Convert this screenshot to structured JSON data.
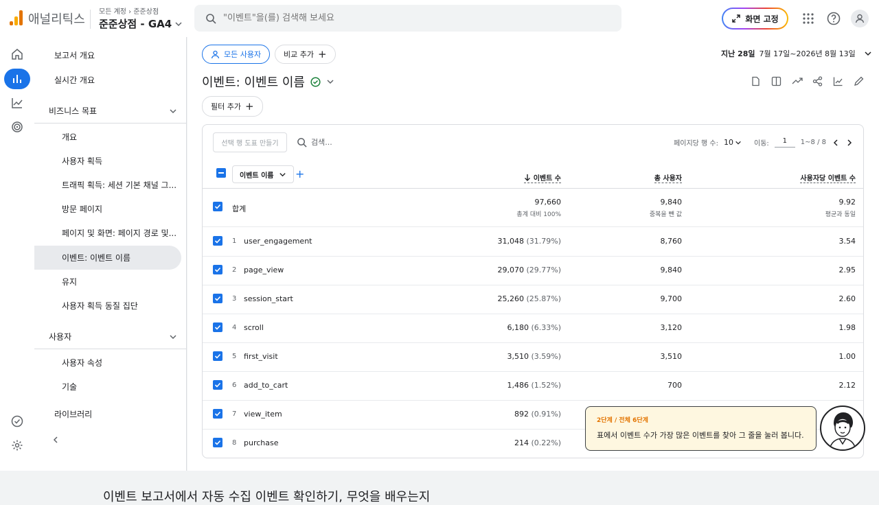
{
  "app": {
    "name": "애널리틱스",
    "account_crumb": [
      "모든 계정",
      "준준상점"
    ],
    "property": "준준상점 - GA4"
  },
  "search": {
    "placeholder": "\"이벤트\"을(를) 검색해 보세요"
  },
  "top": {
    "pin_label": "화면 고정"
  },
  "nav": {
    "items": [
      {
        "label": "보고서 개요"
      },
      {
        "label": "실시간 개요"
      }
    ],
    "section_business": "비즈니스 목표",
    "business_items": [
      {
        "label": "개요"
      },
      {
        "label": "사용자 획득"
      },
      {
        "label": "트래픽 획득: 세션 기본 채널 그..."
      },
      {
        "label": "방문 페이지"
      },
      {
        "label": "페이지 및 화면: 페이지 경로 및..."
      },
      {
        "label": "이벤트: 이벤트 이름"
      },
      {
        "label": "유지"
      },
      {
        "label": "사용자 획득 동질 집단"
      }
    ],
    "section_users": "사용자",
    "user_items": [
      {
        "label": "사용자 속성"
      },
      {
        "label": "기술"
      }
    ],
    "library": "라이브러리"
  },
  "toolbar": {
    "all_users": "모든 사용자",
    "compare": "비교 추가",
    "filter": "필터 추가"
  },
  "date": {
    "preset": "지난 28일",
    "range": "7월 17일~2026년 8월 13일"
  },
  "title": "이벤트: 이벤트 이름",
  "table": {
    "make_chart": "선택 행 도표 만들기",
    "search_placeholder": "검색...",
    "rows_per_page_label": "페이지당 행 수:",
    "rows_per_page": "10",
    "goto_label": "이동:",
    "goto_value": "1",
    "range": "1~8 / 8",
    "dimension": "이벤트 이름",
    "headers": {
      "events": "이벤트 수",
      "users": "총 사용자",
      "per_user": "사용자당 이벤트 수"
    },
    "total": {
      "label": "합계",
      "events": "97,660",
      "events_sub": "총계 대비 100%",
      "users": "9,840",
      "users_sub": "중복을 뺀 값",
      "per_user": "9.92",
      "per_user_sub": "평균과 동일"
    },
    "rows": [
      {
        "idx": "1",
        "name": "user_engagement",
        "events": "31,048",
        "pct": "(31.79%)",
        "users": "8,760",
        "per_user": "3.54"
      },
      {
        "idx": "2",
        "name": "page_view",
        "events": "29,070",
        "pct": "(29.77%)",
        "users": "9,840",
        "per_user": "2.95"
      },
      {
        "idx": "3",
        "name": "session_start",
        "events": "25,260",
        "pct": "(25.87%)",
        "users": "9,700",
        "per_user": "2.60"
      },
      {
        "idx": "4",
        "name": "scroll",
        "events": "6,180",
        "pct": "(6.33%)",
        "users": "3,120",
        "per_user": "1.98"
      },
      {
        "idx": "5",
        "name": "first_visit",
        "events": "3,510",
        "pct": "(3.59%)",
        "users": "3,510",
        "per_user": "1.00"
      },
      {
        "idx": "6",
        "name": "add_to_cart",
        "events": "1,486",
        "pct": "(1.52%)",
        "users": "700",
        "per_user": "2.12"
      },
      {
        "idx": "7",
        "name": "view_item",
        "events": "892",
        "pct": "(0.91%)",
        "users": "",
        "per_user": ""
      },
      {
        "idx": "8",
        "name": "purchase",
        "events": "214",
        "pct": "(0.22%)",
        "users": "",
        "per_user": ""
      }
    ]
  },
  "tip": {
    "step": "2단계 / 전체 6단계",
    "message": "표에서 이벤트 수가 가장 많은 이벤트를 찾아 그 줄을 눌러 봅니다."
  },
  "footer": {
    "text": "이벤트 보고서에서 자동 수집 이벤트 확인하기, 무엇을 배우는지"
  }
}
